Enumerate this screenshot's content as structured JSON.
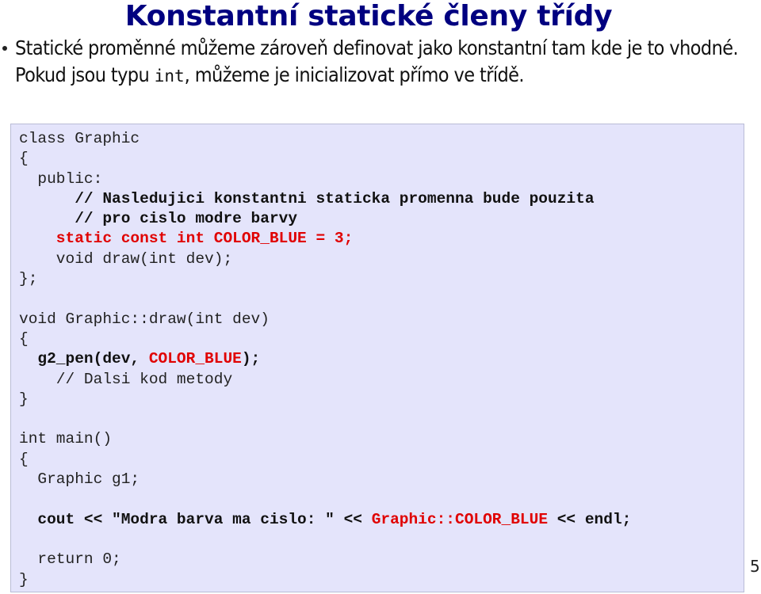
{
  "slide": {
    "title": "Konstantní statické členy třídy",
    "bullet": {
      "text_before": "Statické proměnné můžeme zároveň definovat jako konstantní tam kde je to vhodné. Pokud jsou typu ",
      "inline_code": "int",
      "text_after": ", můžeme je inicializovat přímo ve třídě."
    },
    "page_number": "5",
    "colors": {
      "title": "#000080",
      "code_background": "#e4e4fb",
      "code_border": "#b9bcd6",
      "highlight_red": "#e00000"
    }
  },
  "code": {
    "lines": [
      [
        {
          "text": "class Graphic",
          "style": "plain"
        }
      ],
      [
        {
          "text": "{",
          "style": "plain"
        }
      ],
      [
        {
          "text": "  public:",
          "style": "plain"
        }
      ],
      [
        {
          "text": "      // Nasledujici konstantni staticka promenna bude pouzita",
          "style": "bold"
        }
      ],
      [
        {
          "text": "      // pro cislo modre barvy",
          "style": "bold"
        }
      ],
      [
        {
          "text": "    static const int COLOR_BLUE = 3;",
          "style": "red"
        }
      ],
      [
        {
          "text": "    void draw(int dev);",
          "style": "plain"
        }
      ],
      [
        {
          "text": "};",
          "style": "plain"
        }
      ],
      [
        {
          "text": "",
          "style": "plain"
        }
      ],
      [
        {
          "text": "void Graphic::draw(int dev)",
          "style": "plain"
        }
      ],
      [
        {
          "text": "{",
          "style": "plain"
        }
      ],
      [
        {
          "text": "  g2_pen(dev, ",
          "style": "bold"
        },
        {
          "text": "COLOR_BLUE",
          "style": "red"
        },
        {
          "text": ");",
          "style": "bold"
        }
      ],
      [
        {
          "text": "    // Dalsi kod metody",
          "style": "plain"
        }
      ],
      [
        {
          "text": "}",
          "style": "plain"
        }
      ],
      [
        {
          "text": "",
          "style": "plain"
        }
      ],
      [
        {
          "text": "int main()",
          "style": "plain"
        }
      ],
      [
        {
          "text": "{",
          "style": "plain"
        }
      ],
      [
        {
          "text": "  Graphic g1;",
          "style": "plain"
        }
      ],
      [
        {
          "text": "",
          "style": "plain"
        }
      ],
      [
        {
          "text": "  cout << \"Modra barva ma cislo: \" << ",
          "style": "bold"
        },
        {
          "text": "Graphic::COLOR_BLUE",
          "style": "red"
        },
        {
          "text": " << endl;",
          "style": "bold"
        }
      ],
      [
        {
          "text": "",
          "style": "plain"
        }
      ],
      [
        {
          "text": "  return 0;",
          "style": "plain"
        }
      ],
      [
        {
          "text": "}",
          "style": "plain"
        }
      ]
    ]
  }
}
